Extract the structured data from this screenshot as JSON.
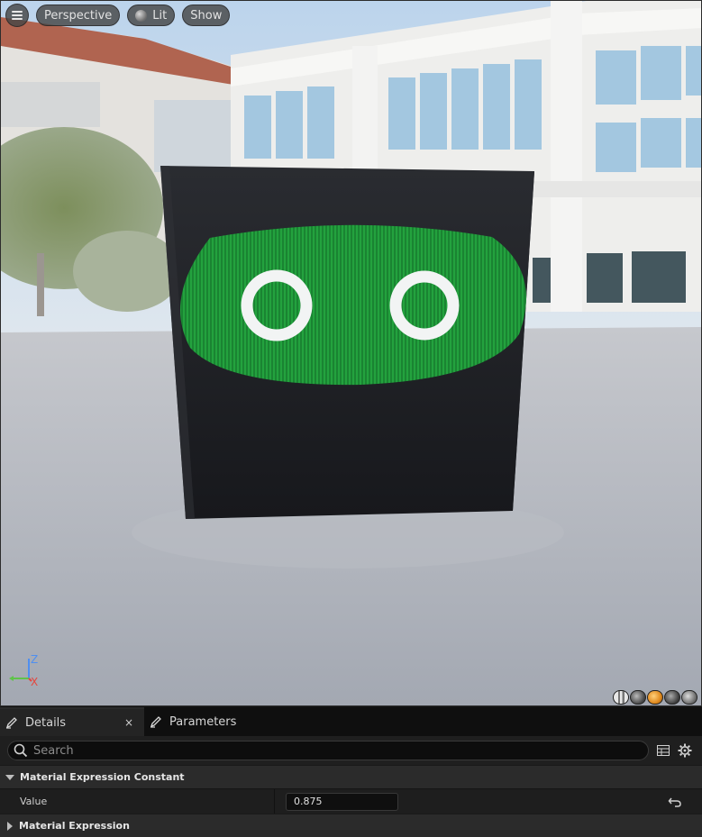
{
  "viewport": {
    "buttons": {
      "perspective_label": "Perspective",
      "lit_label": "Lit",
      "show_label": "Show"
    },
    "axis": {
      "z_label": "Z",
      "x_label": "X"
    },
    "view_mode_icons": [
      "wireframe-sphere-icon",
      "unlit-sphere-icon",
      "lit-sphere-icon",
      "detail-lighting-icon",
      "lighting-only-icon"
    ]
  },
  "panel": {
    "tabs": [
      {
        "label": "Details",
        "active": true,
        "icon": "pencil-icon"
      },
      {
        "label": "Parameters",
        "active": false,
        "icon": "pencil-icon"
      }
    ],
    "close_glyph": "×",
    "search": {
      "placeholder": "Search",
      "value": ""
    },
    "sections": {
      "constant": {
        "title": "Material Expression Constant",
        "expanded": true
      },
      "expression": {
        "title": "Material Expression",
        "expanded": false
      }
    },
    "properties": [
      {
        "name": "Value",
        "value": "0.875"
      }
    ]
  },
  "colors": {
    "accent_orange": "#e08a1e",
    "axis_z": "#4f8ff0",
    "axis_x": "#e4473f",
    "axis_y": "#5fc34a",
    "face_green": "#1f9a3a"
  }
}
